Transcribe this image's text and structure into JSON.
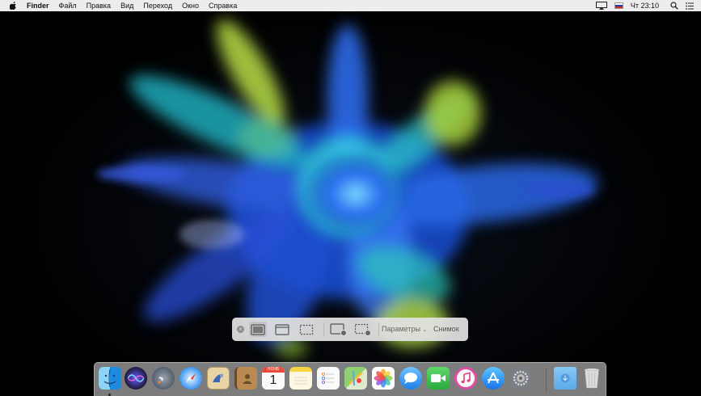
{
  "menubar": {
    "app_name": "Finder",
    "menus": [
      "Файл",
      "Правка",
      "Вид",
      "Переход",
      "Окно",
      "Справка"
    ],
    "clock": "Чт 23:10",
    "status_icons": [
      "airplay-display-icon",
      "input-source-ru-flag-icon",
      "spotlight-search-icon",
      "notification-center-icon"
    ]
  },
  "screenshot_toolbar": {
    "buttons": [
      "close-icon",
      "capture-entire-screen-icon",
      "capture-window-icon",
      "capture-selection-icon",
      "record-entire-screen-icon",
      "record-selection-icon"
    ],
    "options_label": "Параметры",
    "capture_label": "Снимок",
    "selected_index": 0
  },
  "dock": {
    "apps": [
      {
        "name": "Finder",
        "icon": "finder-icon",
        "running": true
      },
      {
        "name": "Siri",
        "icon": "siri-icon"
      },
      {
        "name": "Launchpad",
        "icon": "launchpad-icon"
      },
      {
        "name": "Safari",
        "icon": "safari-icon"
      },
      {
        "name": "Mail",
        "icon": "mail-icon"
      },
      {
        "name": "Contacts",
        "icon": "contacts-icon"
      },
      {
        "name": "Calendar",
        "icon": "calendar-icon",
        "month": "НОЯБ",
        "day": "1"
      },
      {
        "name": "Notes",
        "icon": "notes-icon"
      },
      {
        "name": "Reminders",
        "icon": "reminders-icon"
      },
      {
        "name": "Maps",
        "icon": "maps-icon"
      },
      {
        "name": "Photos",
        "icon": "photos-icon"
      },
      {
        "name": "Messages",
        "icon": "messages-icon"
      },
      {
        "name": "FaceTime",
        "icon": "facetime-icon"
      },
      {
        "name": "iTunes",
        "icon": "itunes-icon"
      },
      {
        "name": "App Store",
        "icon": "app-store-icon"
      },
      {
        "name": "System Preferences",
        "icon": "system-preferences-icon"
      },
      {
        "name": "Downloads",
        "icon": "downloads-folder-icon"
      },
      {
        "name": "Trash",
        "icon": "trash-icon"
      }
    ]
  },
  "colors": {
    "menubar_bg": "#f5f5f5",
    "toolbar_bg": "#e2e2e2",
    "wallpaper_blue": "#1e5bd8",
    "wallpaper_cyan": "#2ad1d6",
    "wallpaper_lime": "#b7dc3c"
  }
}
